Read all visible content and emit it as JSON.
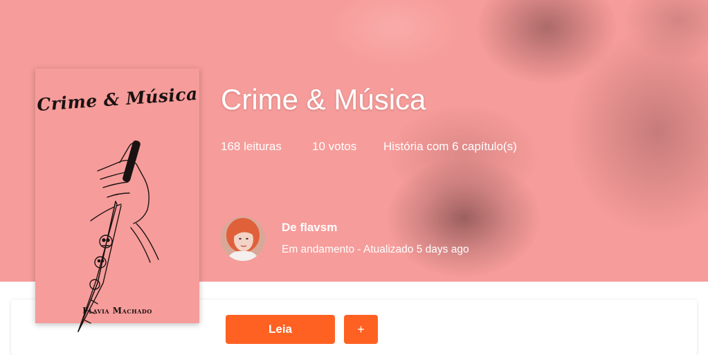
{
  "colors": {
    "hero_background": "#f69c9a",
    "accent": "#ff6122",
    "text_on_hero": "#ffffff"
  },
  "story": {
    "title": "Crime & Música",
    "stats": {
      "reads": "168 leituras",
      "votes": "10 votos",
      "chapters": "História com 6 capítulo(s)"
    }
  },
  "cover": {
    "title_text": "Crime & Música",
    "author_text": "Flavia Machado",
    "art_icon": "hand-holding-knife-illustration"
  },
  "author": {
    "name": "De flavsm",
    "status": "Em andamento - Atualizado 5 days ago",
    "avatar_icon": "user-avatar"
  },
  "actions": {
    "read_label": "Leia",
    "add_label": "+"
  }
}
